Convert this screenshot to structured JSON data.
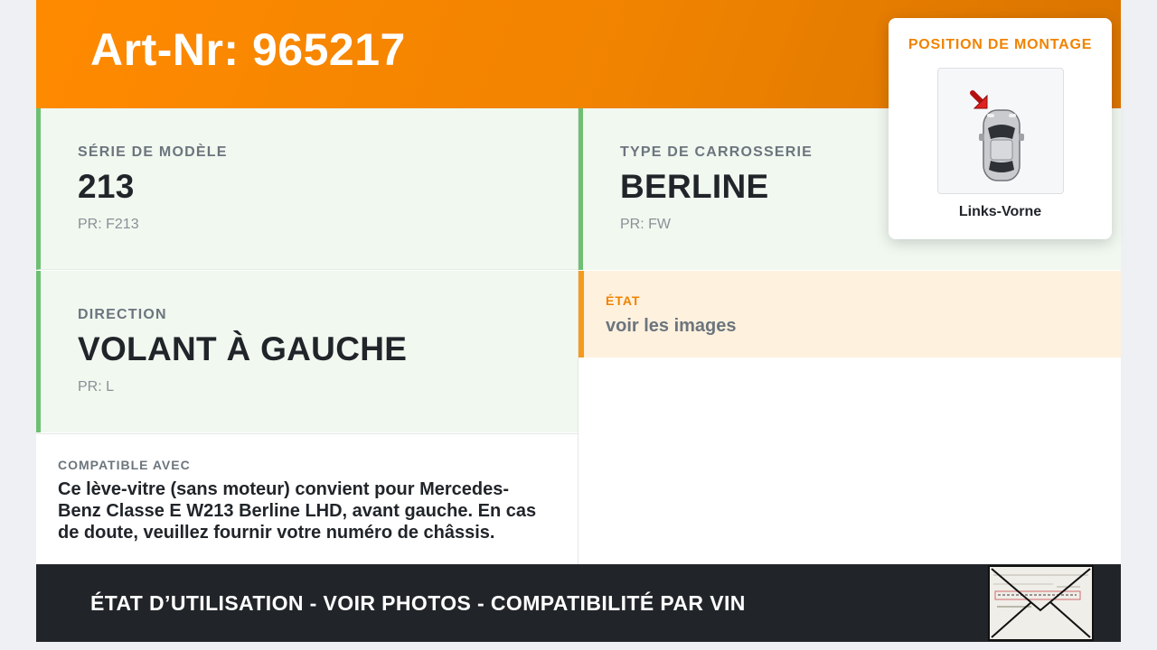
{
  "header": {
    "title": "Art-Nr: 965217",
    "accent_color": "#f08300"
  },
  "fields": {
    "model_series": {
      "label": "SÉRIE DE MODÈLE",
      "value": "213",
      "code": "PR: F213"
    },
    "body_type": {
      "label": "TYPE DE CARROSSERIE",
      "value": "BERLINE",
      "code": "PR: FW"
    },
    "steering": {
      "label": "DIRECTION",
      "value": "VOLANT À GAUCHE",
      "code": "PR: L"
    }
  },
  "condition": {
    "label": "ÉTAT",
    "value": "voir les images"
  },
  "compatibility": {
    "label": "COMPATIBLE AVEC",
    "text": "Ce lève-vitre (sans moteur) convient pour Mercedes-Benz Classe E W213 Berline LHD, avant gauche. En cas de doute, veuillez fournir votre numéro de châssis."
  },
  "mounting": {
    "title": "POSITION DE MONTAGE",
    "position": "Links-Vorne",
    "icon": "car-top-view-icon"
  },
  "footer": {
    "text": "ÉTAT D’UTILISATION - VOIR PHOTOS - COMPATIBILITÉ PAR VIN",
    "icon": "envelope-icon"
  }
}
